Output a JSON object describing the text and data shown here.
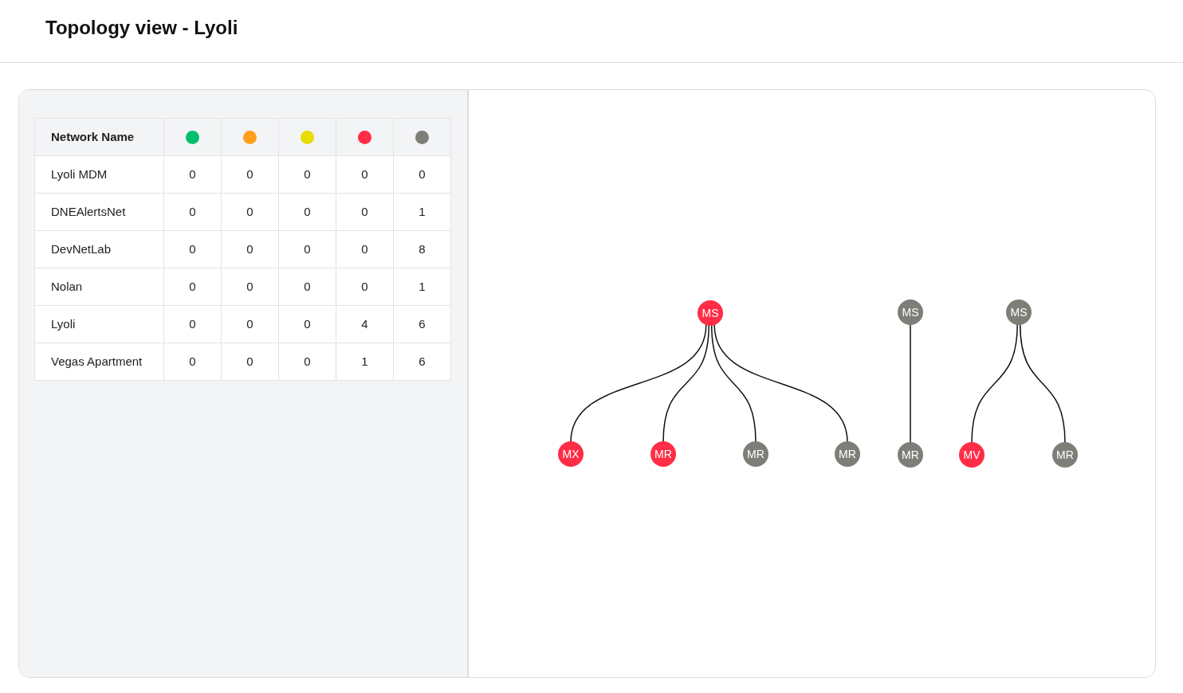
{
  "page": {
    "title": "Topology view - Lyoli"
  },
  "table": {
    "columns": [
      {
        "kind": "text",
        "label": "Network Name"
      },
      {
        "kind": "status",
        "color": "#00c070"
      },
      {
        "kind": "status",
        "color": "#ff9f1c"
      },
      {
        "kind": "status",
        "color": "#e9dc00"
      },
      {
        "kind": "status",
        "color": "#ff2d46"
      },
      {
        "kind": "status",
        "color": "#7e7e78"
      }
    ],
    "rows": [
      [
        "Lyoli MDM",
        "0",
        "0",
        "0",
        "0",
        "0"
      ],
      [
        "DNEAlertsNet",
        "0",
        "0",
        "0",
        "0",
        "1"
      ],
      [
        "DevNetLab",
        "0",
        "0",
        "0",
        "0",
        "8"
      ],
      [
        "Nolan",
        "0",
        "0",
        "0",
        "0",
        "1"
      ],
      [
        "Lyoli",
        "0",
        "0",
        "0",
        "4",
        "6"
      ],
      [
        "Vegas Apartment",
        "0",
        "0",
        "0",
        "1",
        "6"
      ]
    ]
  },
  "topology": {
    "groups": [
      {
        "root": {
          "label": "MS",
          "color": "#ff2d46"
        },
        "children": [
          {
            "label": "MX",
            "color": "#ff2d46"
          },
          {
            "label": "MR",
            "color": "#ff2d46"
          },
          {
            "label": "MR",
            "color": "#7e7e78"
          },
          {
            "label": "MR",
            "color": "#7e7e78"
          }
        ]
      },
      {
        "root": {
          "label": "MS",
          "color": "#7e7e78"
        },
        "children": [
          {
            "label": "MR",
            "color": "#7e7e78"
          }
        ]
      },
      {
        "root": {
          "label": "MS",
          "color": "#7e7e78"
        },
        "children": [
          {
            "label": "MV",
            "color": "#ff2d46"
          },
          {
            "label": "MR",
            "color": "#7e7e78"
          }
        ]
      }
    ]
  }
}
